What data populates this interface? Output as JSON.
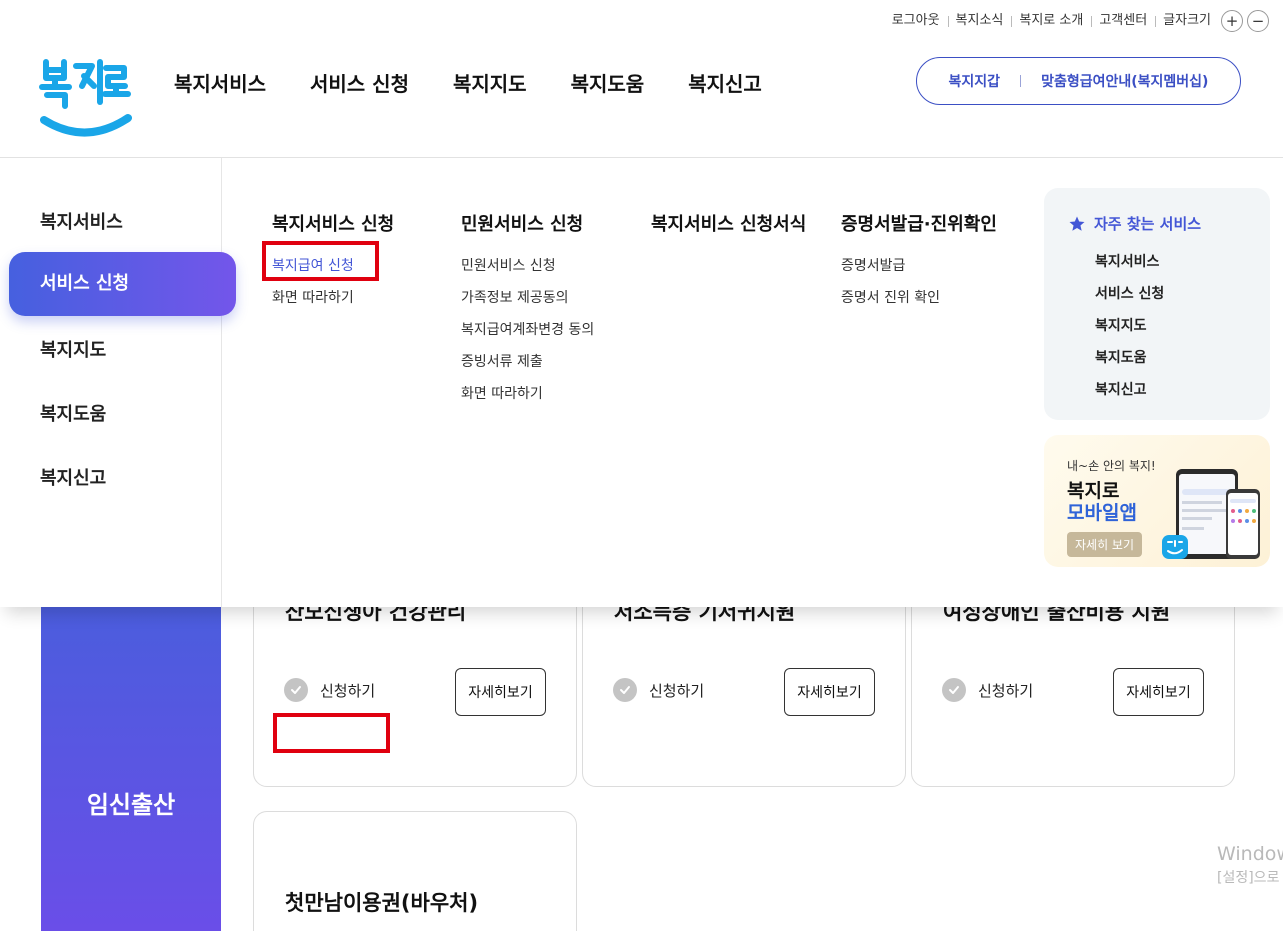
{
  "utility": {
    "logout": "로그아웃",
    "news": "복지소식",
    "about": "복지로 소개",
    "support": "고객센터",
    "font_size": "글자크기",
    "plus": "+",
    "minus": "−"
  },
  "gnb": [
    "복지서비스",
    "서비스 신청",
    "복지지도",
    "복지도움",
    "복지신고"
  ],
  "pill": {
    "wallet": "복지지갑",
    "membership": "맞춤형급여안내(복지멤버십)"
  },
  "mega": {
    "side": [
      "복지서비스",
      "서비스 신청",
      "복지지도",
      "복지도움",
      "복지신고"
    ],
    "columns": [
      {
        "title": "복지서비스 신청",
        "links": [
          "복지급여 신청",
          "화면 따라하기"
        ]
      },
      {
        "title": "민원서비스 신청",
        "links": [
          "민원서비스 신청",
          "가족정보 제공동의",
          "복지급여계좌변경 동의",
          "증빙서류 제출",
          "화면 따라하기"
        ]
      },
      {
        "title": "복지서비스 신청서식",
        "links": []
      },
      {
        "title": "증명서발급·진위확인",
        "links": [
          "증명서발급",
          "증명서 진위 확인"
        ]
      }
    ],
    "favorites": {
      "title": "자주 찾는 서비스",
      "links": [
        "복지서비스",
        "서비스 신청",
        "복지지도",
        "복지도움",
        "복지신고"
      ]
    },
    "banner": {
      "sub": "내~손 안의 복지!",
      "line1": "복지로",
      "line2": "모바일앱",
      "button": "자세히 보기"
    }
  },
  "page": {
    "category": "임신출산",
    "cards": [
      {
        "title": "산모신생아 건강관리",
        "apply": "신청하기",
        "detail": "자세히보기"
      },
      {
        "title": "저소득층 기저귀지원",
        "apply": "신청하기",
        "detail": "자세히보기"
      },
      {
        "title": "여성장애인 출산비용 지원",
        "apply": "신청하기",
        "detail": "자세히보기"
      },
      {
        "title": "첫만남이용권(바우처)"
      }
    ]
  },
  "watermark": {
    "line1": "Window",
    "line2": "[설정]으로"
  },
  "colors": {
    "accent": "#4356d6",
    "brand_gradient_start": "#4660df",
    "brand_gradient_end": "#7356ea",
    "highlight": "#e0000f"
  }
}
